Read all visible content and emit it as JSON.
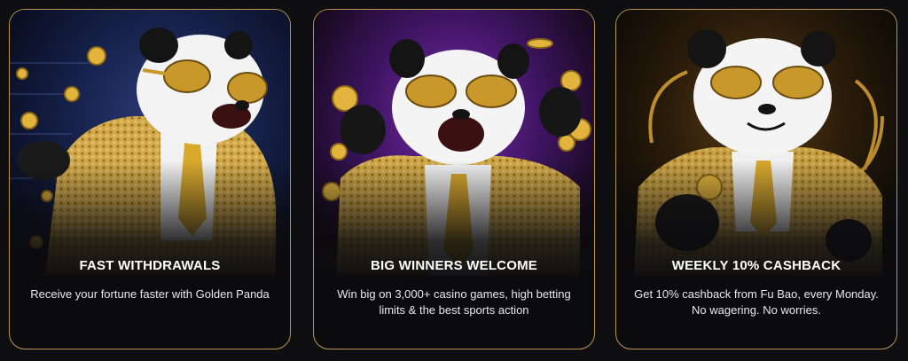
{
  "cards": [
    {
      "title": "FAST WITHDRAWALS",
      "description": "Receive your fortune faster with Golden Panda",
      "image": "golden-panda-running-with-coins"
    },
    {
      "title": "BIG WINNERS WELCOME",
      "description": "Win big on 3,000+ casino games, high betting limits & the best sports action",
      "image": "golden-panda-celebrating-with-coins"
    },
    {
      "title": "WEEKLY 10% CASHBACK",
      "description": "Get 10% cashback from Fu Bao, every Monday. No wagering. No worries.",
      "image": "golden-panda-holding-coin"
    }
  ],
  "colors": {
    "page_background": "#0f0f12",
    "card_border": "#b99452",
    "gold": "#d8ab3a",
    "text": "#ffffff"
  }
}
